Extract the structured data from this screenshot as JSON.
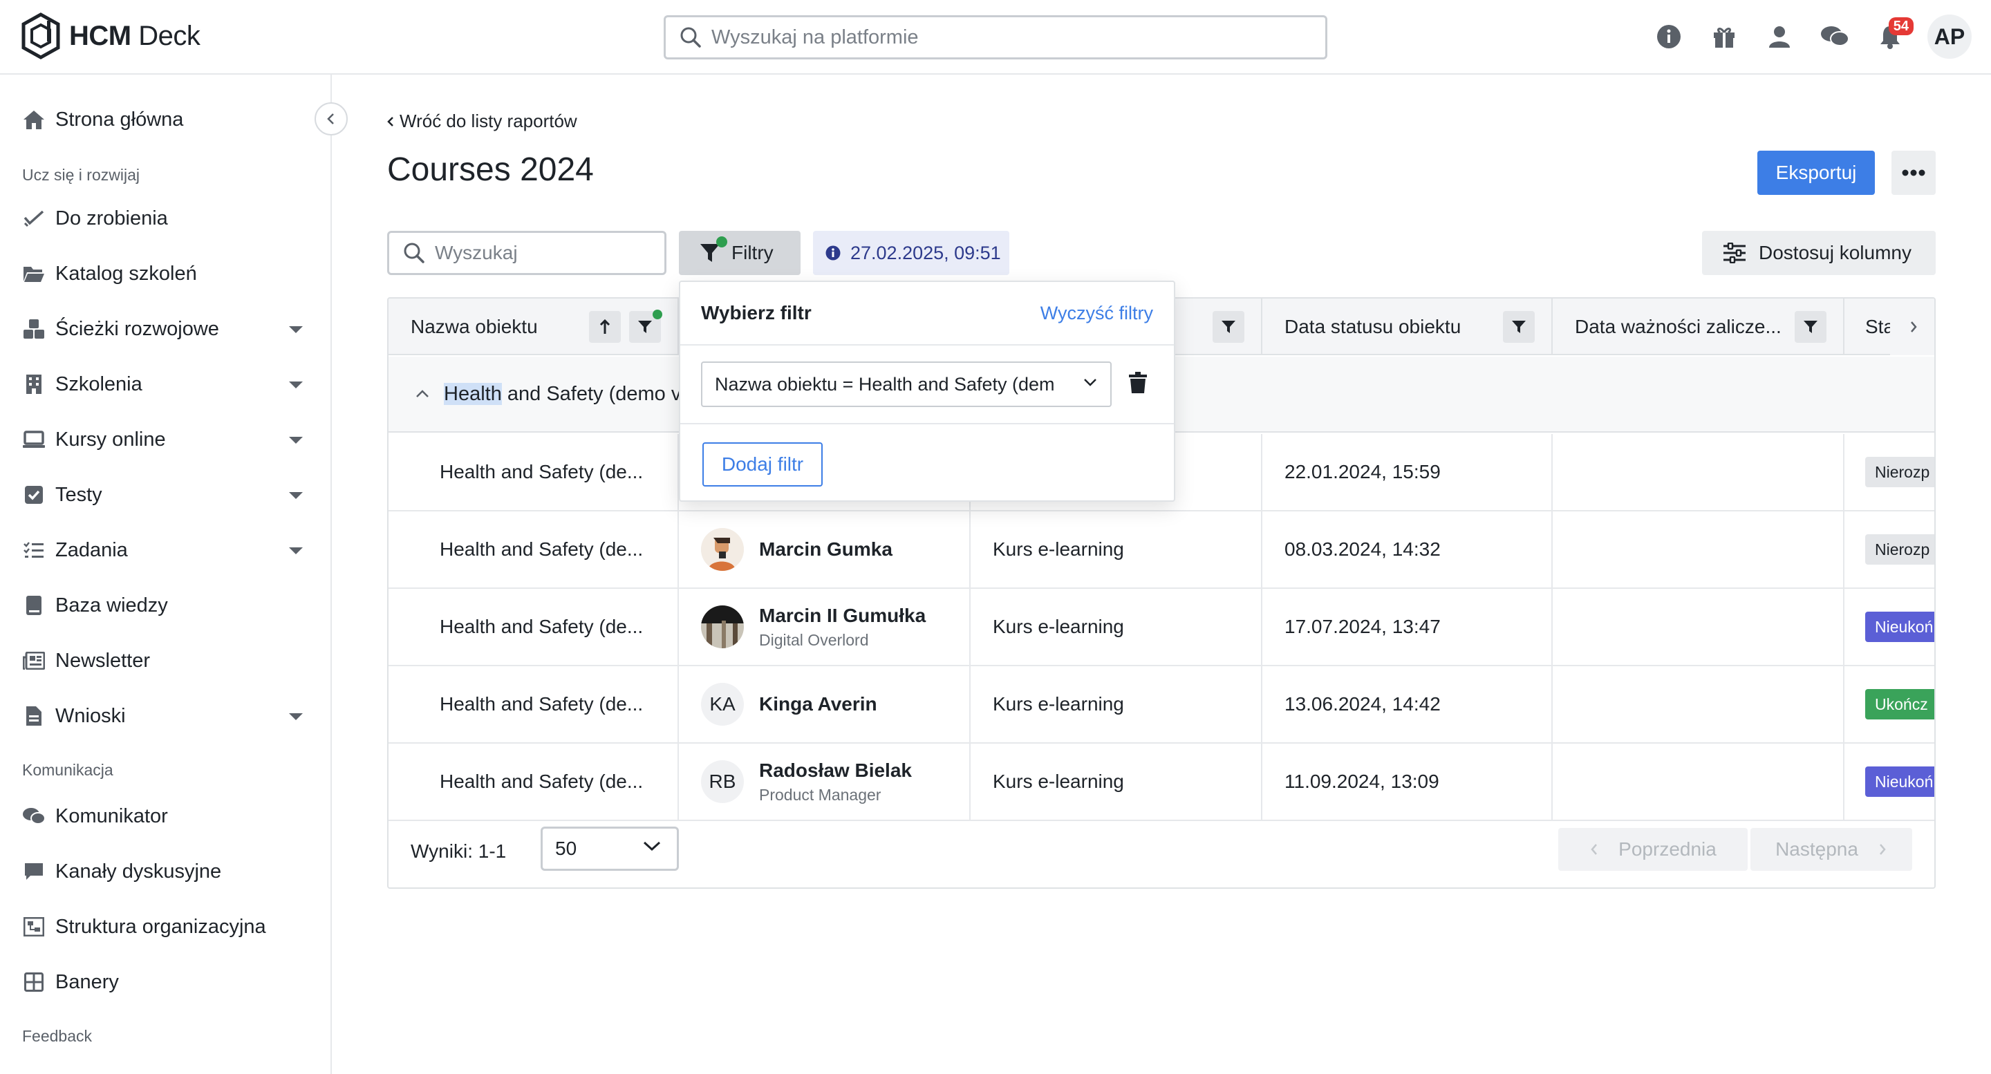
{
  "app": {
    "logo_text_bold": "HCM",
    "logo_text_light": "Deck"
  },
  "header": {
    "search_placeholder": "Wyszukaj na platformie",
    "notification_count": "54",
    "user_initials": "AP"
  },
  "sidebar": {
    "items": [
      {
        "label": "Strona główna",
        "icon": "home-icon"
      },
      {
        "label": "Do zrobienia",
        "icon": "checkmark-icon"
      },
      {
        "label": "Katalog szkoleń",
        "icon": "folder-icon"
      },
      {
        "label": "Ścieżki rozwojowe",
        "icon": "cubes-icon"
      },
      {
        "label": "Szkolenia",
        "icon": "building-icon"
      },
      {
        "label": "Kursy online",
        "icon": "laptop-icon"
      },
      {
        "label": "Testy",
        "icon": "checkbox-icon"
      },
      {
        "label": "Zadania",
        "icon": "list-icon"
      },
      {
        "label": "Baza wiedzy",
        "icon": "book-icon"
      },
      {
        "label": "Newsletter",
        "icon": "newspaper-icon"
      },
      {
        "label": "Wnioski",
        "icon": "document-icon"
      },
      {
        "label": "Komunikator",
        "icon": "chat-icon"
      },
      {
        "label": "Kanały dyskusyjne",
        "icon": "comment-icon"
      },
      {
        "label": "Struktura organizacyjna",
        "icon": "org-chart-icon"
      },
      {
        "label": "Banery",
        "icon": "grid-icon"
      }
    ],
    "sections": [
      "Ucz się i rozwijaj",
      "Komunikacja",
      "Feedback"
    ]
  },
  "main": {
    "back_label": "Wróć do listy raportów",
    "title": "Courses 2024",
    "export_label": "Eksportuj",
    "search_placeholder": "Wyszukaj",
    "filters_label": "Filtry",
    "date_label": "27.02.2025, 09:51",
    "columns_label": "Dostosuj kolumny"
  },
  "table": {
    "headers": [
      "Nazwa obiektu",
      "Data statusu obiektu",
      "Data ważności zalicze...",
      "Sta"
    ],
    "group_label_highlight": "Health",
    "group_label_rest": " and Safety (demo v",
    "rows": [
      {
        "object": "Health and Safety (de...",
        "user": "",
        "user_sub": "",
        "initials": "",
        "type": "",
        "date": "22.01.2024, 15:59",
        "status": "Nierozp",
        "status_style": "grey"
      },
      {
        "object": "Health and Safety (de...",
        "user": "Marcin Gumka",
        "user_sub": "",
        "initials": "",
        "type": "Kurs e-learning",
        "date": "08.03.2024, 14:32",
        "status": "Nierozp",
        "status_style": "grey"
      },
      {
        "object": "Health and Safety (de...",
        "user": "Marcin II Gumułka",
        "user_sub": "Digital Overlord",
        "initials": "",
        "type": "Kurs e-learning",
        "date": "17.07.2024, 13:47",
        "status": "Nieukoń",
        "status_style": "blue"
      },
      {
        "object": "Health and Safety (de...",
        "user": "Kinga Averin",
        "user_sub": "",
        "initials": "KA",
        "type": "Kurs e-learning",
        "date": "13.06.2024, 14:42",
        "status": "Ukończ",
        "status_style": "green"
      },
      {
        "object": "Health and Safety (de...",
        "user": "Radosław Bielak",
        "user_sub": "Product Manager",
        "initials": "RB",
        "type": "Kurs e-learning",
        "date": "11.09.2024, 13:09",
        "status": "Nieukoń",
        "status_style": "blue"
      }
    ],
    "results_label": "Wyniki: 1-1",
    "per_page": "50",
    "prev_label": "Poprzednia",
    "next_label": "Następna"
  },
  "filter_popover": {
    "title": "Wybierz filtr",
    "clear_label": "Wyczyść filtry",
    "filter_field": "Nazwa obiektu",
    "filter_op": " = ",
    "filter_value": "Health and Safety (dem",
    "add_label": "Dodaj filtr"
  },
  "colors": {
    "accent": "#3d7ee6",
    "status_grey": "#e4e6e9",
    "status_blue": "#5b5fd6",
    "status_green": "#3aa35a"
  }
}
